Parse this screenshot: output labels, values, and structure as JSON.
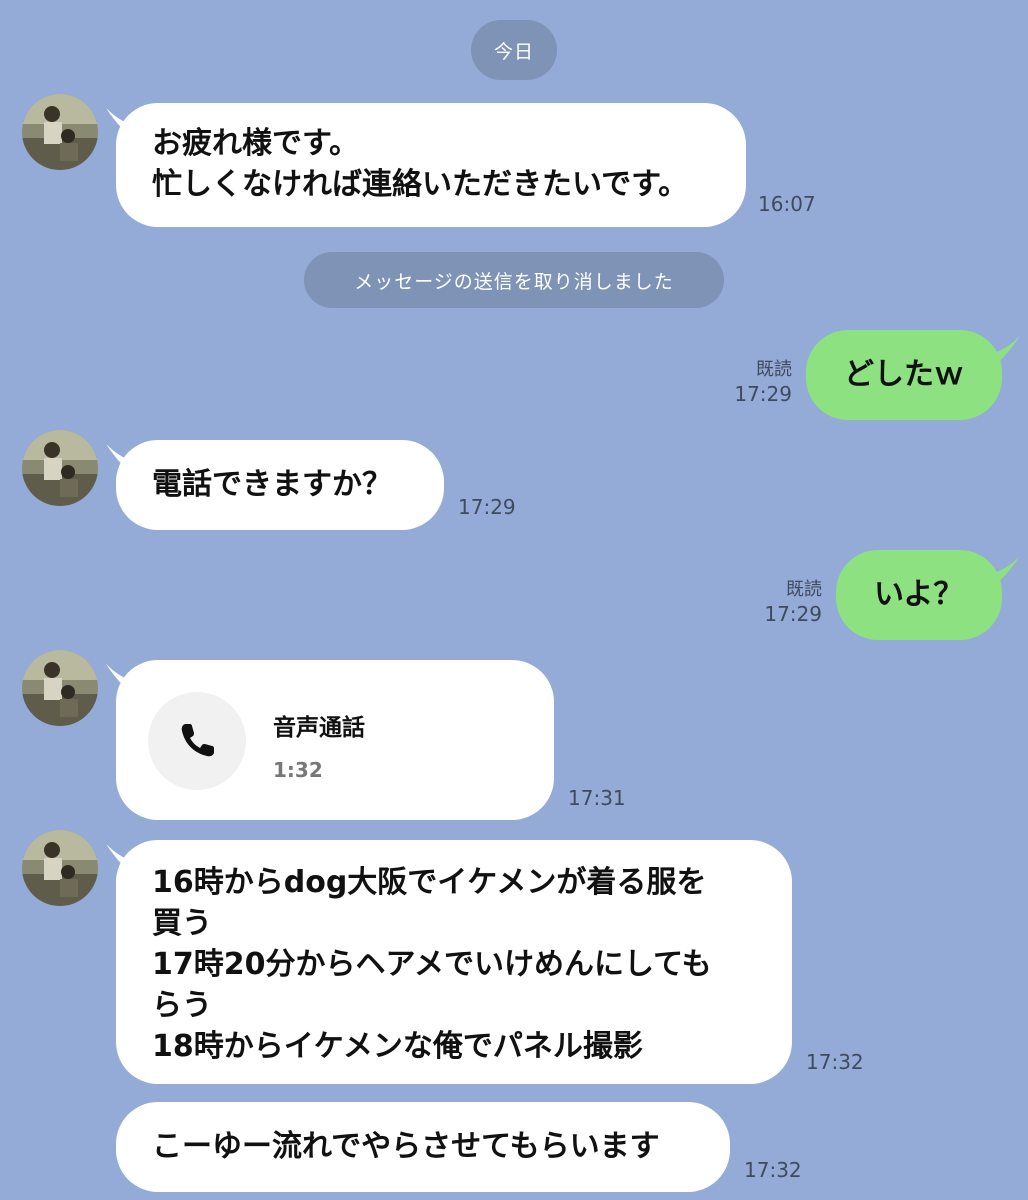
{
  "date_separator": "今日",
  "system_notice": "メッセージの送信を取り消しました",
  "read_label": "既読",
  "messages": [
    {
      "text": "お疲れ様です。\n忙しくなければ連絡いただきたいです。",
      "time": "16:07"
    },
    {
      "text": "どしたｗ",
      "time": "17:29"
    },
    {
      "text": "電話できますか？",
      "time": "17:29"
    },
    {
      "text": "いよ？",
      "time": "17:29"
    },
    {
      "call_title": "音声通話",
      "call_duration": "1:32",
      "time": "17:31",
      "icon": "phone-icon"
    },
    {
      "text": "16時からdog大阪でイケメンが着る服を\n買う\n17時20分からヘアメでいけめんにしても\nらう\n18時からイケメンな俺でパネル撮影",
      "time": "17:32"
    },
    {
      "text": "こーゆー流れでやらさせてもらいます",
      "time": "17:32"
    }
  ],
  "colors": {
    "background": "#93abd6",
    "incoming_bubble": "#ffffff",
    "outgoing_bubble": "#8de180",
    "pill": "#7e93b6"
  }
}
